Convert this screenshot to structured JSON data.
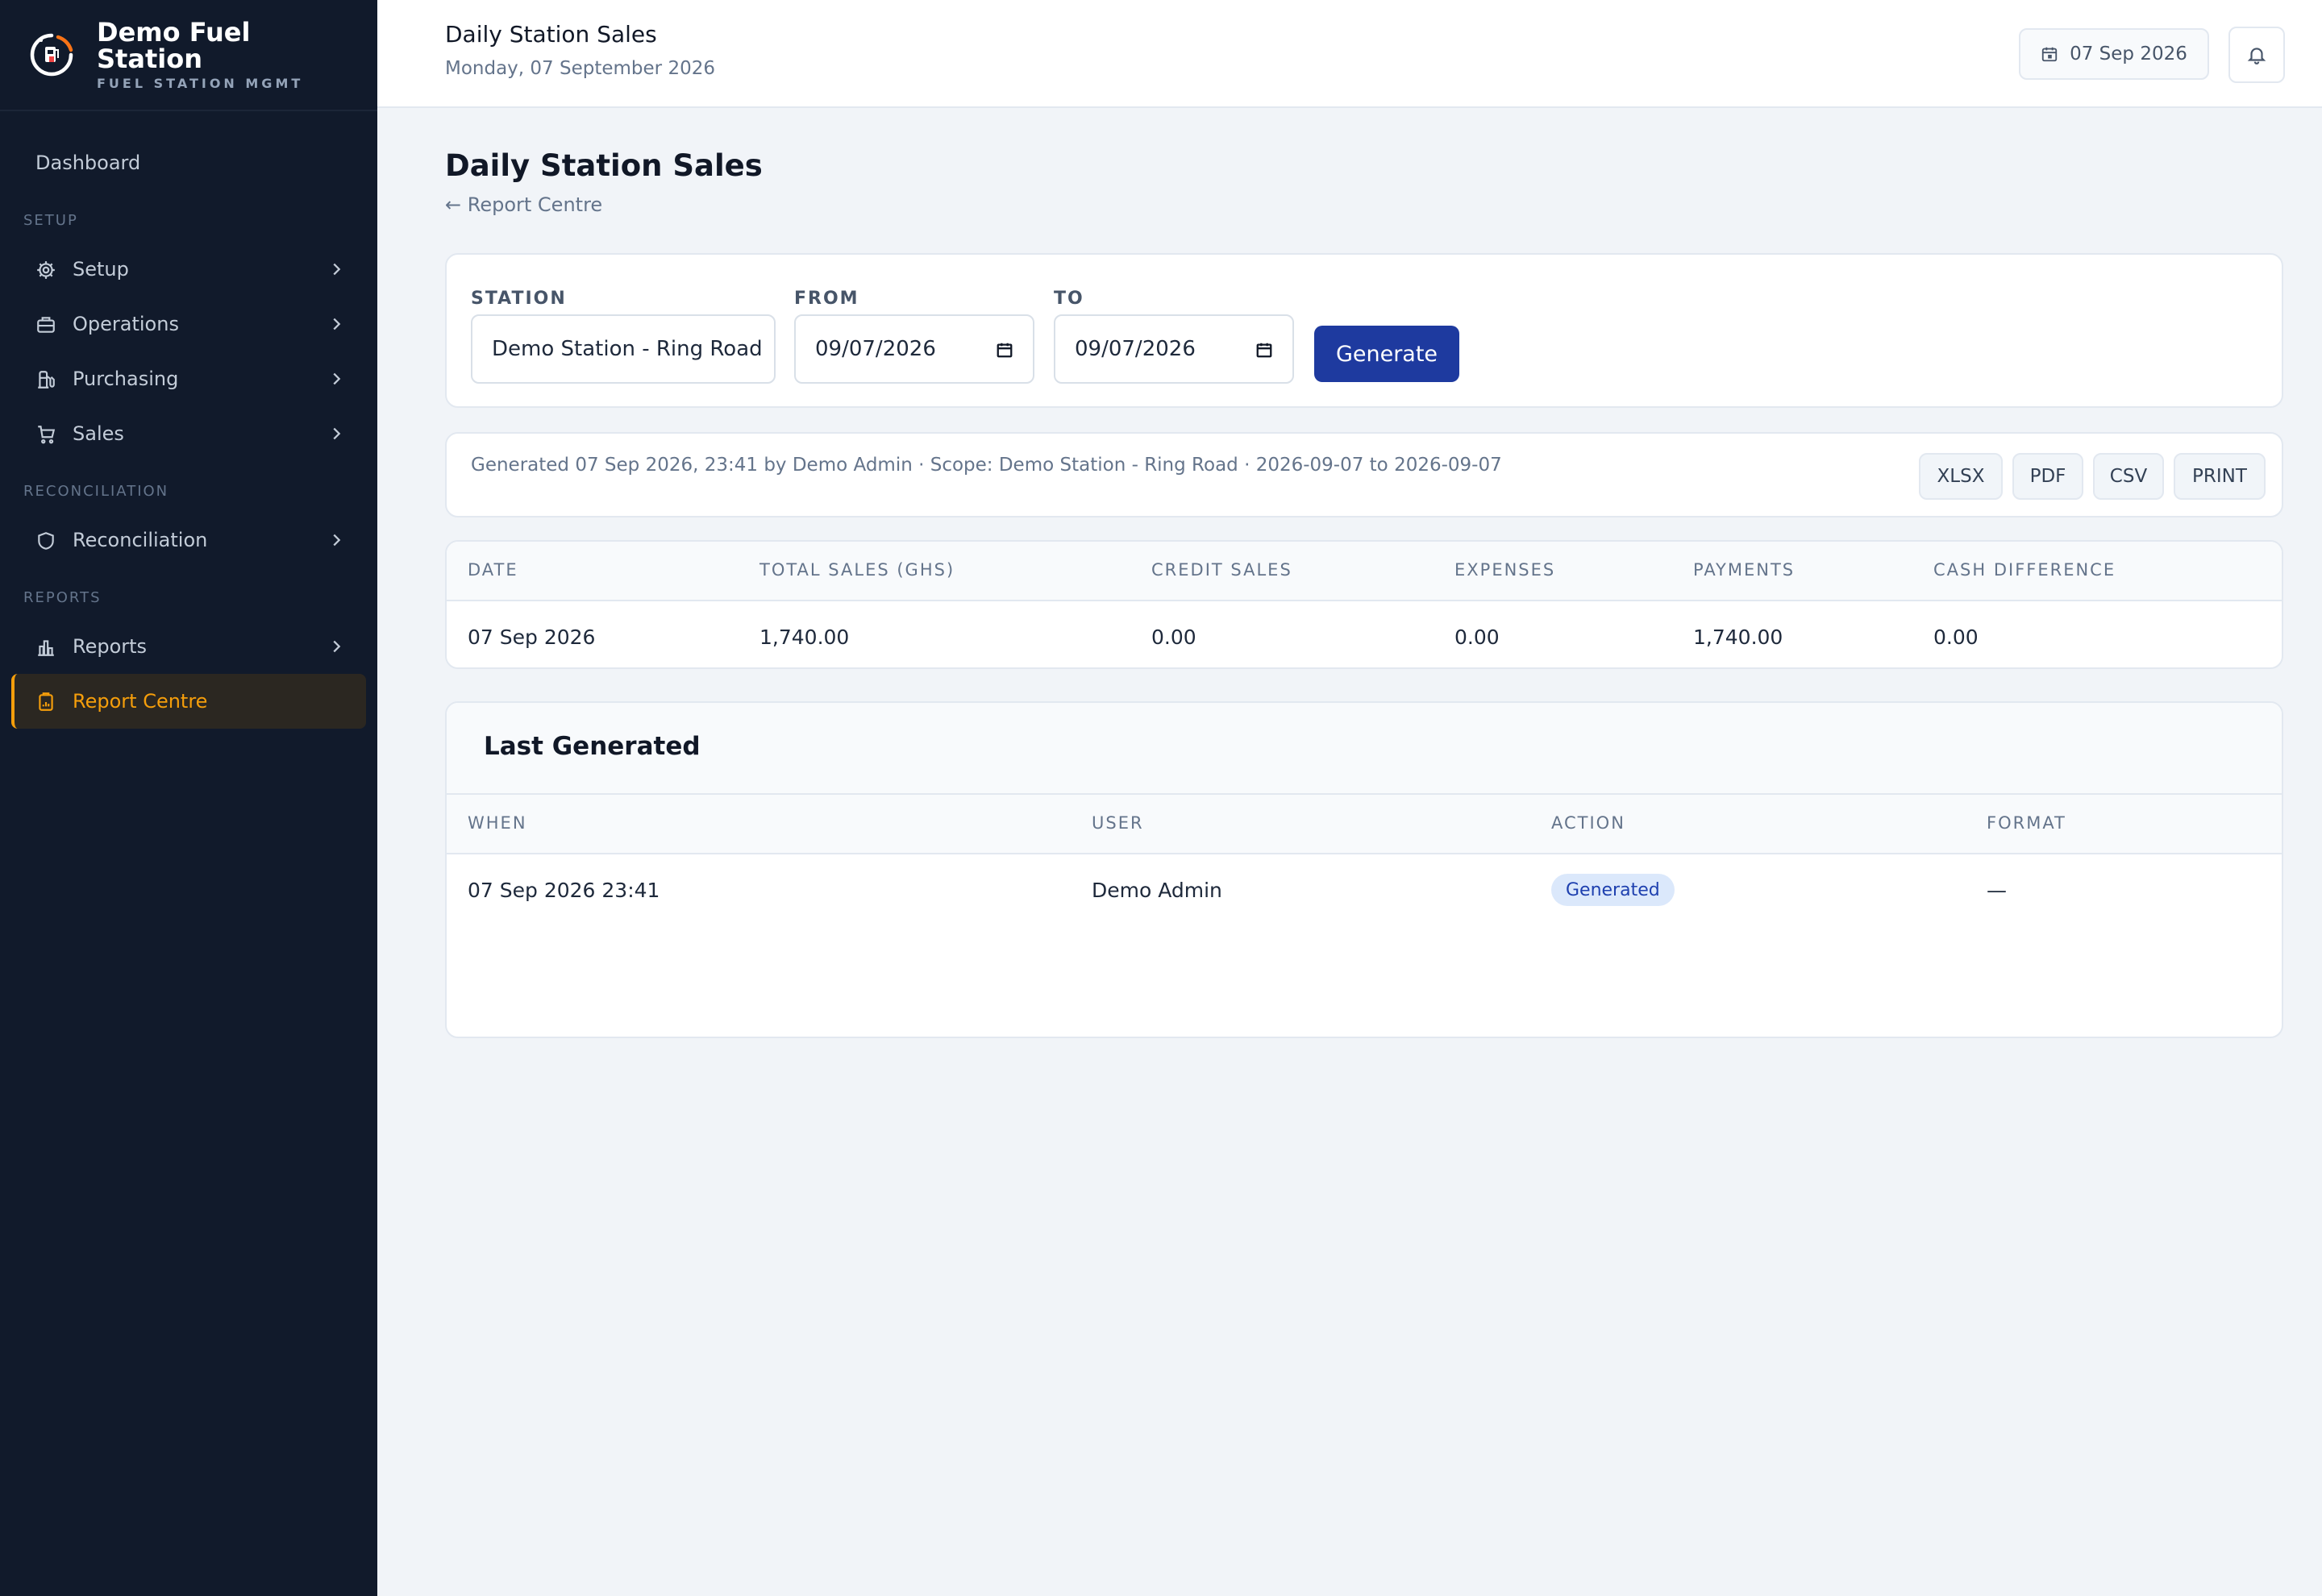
{
  "brand": {
    "name": "Demo Fuel Station",
    "subtitle": "FUEL STATION MGMT"
  },
  "sidebar": {
    "dashboard": "Dashboard",
    "sections": {
      "setup": "SETUP",
      "reconciliation": "RECONCILIATION",
      "reports": "REPORTS"
    },
    "items": [
      {
        "label": "Setup",
        "icon": "gear-icon"
      },
      {
        "label": "Operations",
        "icon": "briefcase-icon"
      },
      {
        "label": "Purchasing",
        "icon": "fuel-pump-icon"
      },
      {
        "label": "Sales",
        "icon": "cart-icon"
      },
      {
        "label": "Reconciliation",
        "icon": "shield-icon"
      },
      {
        "label": "Reports",
        "icon": "bar-chart-icon"
      },
      {
        "label": "Report Centre",
        "icon": "clipboard-icon",
        "active": true
      }
    ]
  },
  "header": {
    "title": "Daily Station Sales",
    "date_long": "Monday, 07 September 2026",
    "date_chip": "07 Sep 2026"
  },
  "page": {
    "title": "Daily Station Sales",
    "back_link": "← Report Centre"
  },
  "filters": {
    "station_label": "STATION",
    "station_value": "Demo Station - Ring Road",
    "from_label": "FROM",
    "from_value": "09/07/2026",
    "to_label": "TO",
    "to_value": "09/07/2026",
    "generate_label": "Generate"
  },
  "meta": {
    "text": "Generated 07 Sep 2026, 23:41 by Demo Admin · Scope: Demo Station - Ring Road · 2026-09-07 to 2026-09-07",
    "exports": [
      "XLSX",
      "PDF",
      "CSV",
      "PRINT"
    ]
  },
  "sales_table": {
    "headers": [
      "DATE",
      "TOTAL SALES (GHS)",
      "CREDIT SALES",
      "EXPENSES",
      "PAYMENTS",
      "CASH DIFFERENCE"
    ],
    "rows": [
      [
        "07 Sep 2026",
        "1,740.00",
        "0.00",
        "0.00",
        "1,740.00",
        "0.00"
      ]
    ]
  },
  "last_generated": {
    "title": "Last Generated",
    "headers": [
      "WHEN",
      "USER",
      "ACTION",
      "FORMAT"
    ],
    "rows": [
      [
        "07 Sep 2026 23:41",
        "Demo Admin",
        "Generated",
        "—"
      ]
    ]
  },
  "colors": {
    "sidebar_bg": "#111a2b",
    "accent": "#f59e0b",
    "primary": "#1e3a9f",
    "badge_bg": "#dbe8fb"
  }
}
